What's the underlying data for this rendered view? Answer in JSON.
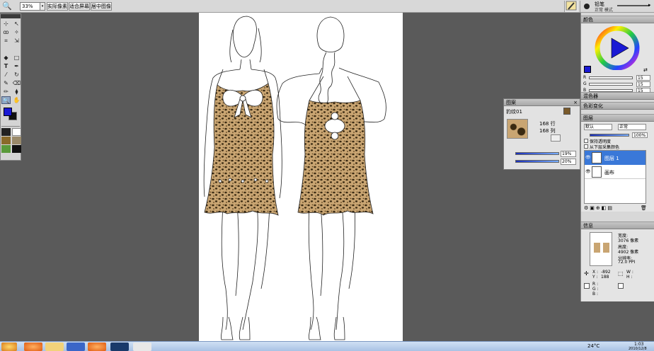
{
  "toolbar": {
    "zoom_value": "33%",
    "btn_actual_pixels": "实际像素",
    "btn_fit_screen": "适合屏幕",
    "btn_center_image": "居中图像"
  },
  "brush_panel": {
    "label_brush": "铅笔",
    "label_mode": "正常 模式"
  },
  "color_panel": {
    "title": "颜色",
    "r_label": "R",
    "r_value": "15",
    "g_label": "G",
    "g_value": "15",
    "b_label": "B",
    "b_value": "15",
    "mixer_label": "混色器",
    "variant_label": "色彩变化"
  },
  "pattern_panel": {
    "title": "图案",
    "name": "豹纹01",
    "rows": "168 行",
    "cols": "168 列",
    "value1": "19%",
    "value2": "20%"
  },
  "layers_panel": {
    "title": "图层",
    "mode": "默认",
    "blend": "正常",
    "opacity": "100%",
    "keep_transparency": "保持透明度",
    "sample_below": "从下层采集颜色",
    "layer1_name": "图层 1",
    "canvas_layer_name": "画布"
  },
  "info_panel": {
    "title": "信息",
    "width_label": "宽度:",
    "width_value": "3076 像素",
    "height_label": "高度:",
    "height_value": "4902 像素",
    "res_label": "分辨率:",
    "res_value": "72.0 PPI",
    "x_label": "X :",
    "x_value": "-892",
    "y_label": "Y :",
    "y_value": "188",
    "w_label": "W :",
    "h_label": "H :",
    "r_label": "R :",
    "g_label": "G :",
    "b_label": "B :"
  },
  "taskbar": {
    "time": "1:03",
    "date": "2010/12/8",
    "temp": "24°C"
  }
}
